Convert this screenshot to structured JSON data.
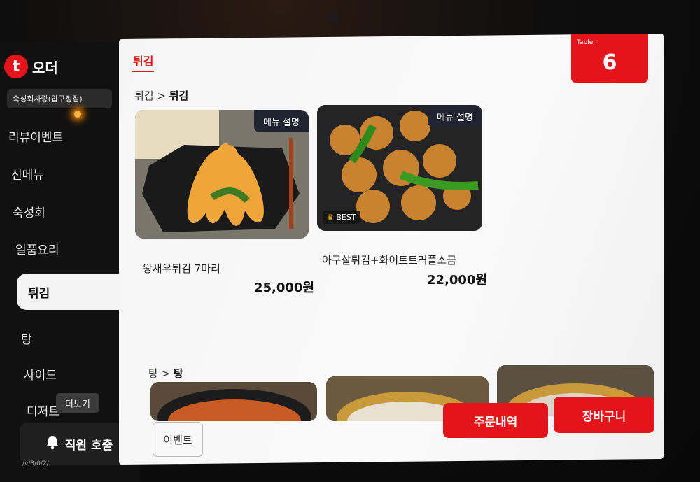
{
  "brand": {
    "logo_letter": "t",
    "logo_text": "오더"
  },
  "store_name": "숙성회사랑(압구정점)",
  "sidebar": {
    "categories": [
      "리뷰이벤트",
      "신메뉴",
      "숙성회",
      "일품요리",
      "튀김",
      "탕",
      "사이드",
      "디저트"
    ],
    "active": "튀김",
    "more_label": "더보기",
    "staff_call_label": "직원 호출",
    "version": "/v/3/0/2/"
  },
  "header": {
    "tab_title": "튀김",
    "table_label": "Table.",
    "table_number": "6"
  },
  "sections": [
    {
      "crumb_parent": "튀김",
      "crumb_sep": ">",
      "crumb_current": "튀김",
      "items": [
        {
          "name": "왕새우튀김 7마리",
          "price": "25,000원",
          "desc_button": "메뉴 설명",
          "badge": ""
        },
        {
          "name": "아구살튀김+화이트트러플소금",
          "price": "22,000원",
          "desc_button": "메뉴 설명",
          "badge": "BEST"
        }
      ]
    },
    {
      "crumb_parent": "탕",
      "crumb_sep": ">",
      "crumb_current": "탕"
    }
  ],
  "footer": {
    "event_label": "이벤트",
    "order_history_label": "주문내역",
    "cart_label": "장바구니"
  },
  "colors": {
    "accent": "#e5141b",
    "sidebar_bg": "#111111",
    "panel_bg": "#f5f5f5"
  }
}
